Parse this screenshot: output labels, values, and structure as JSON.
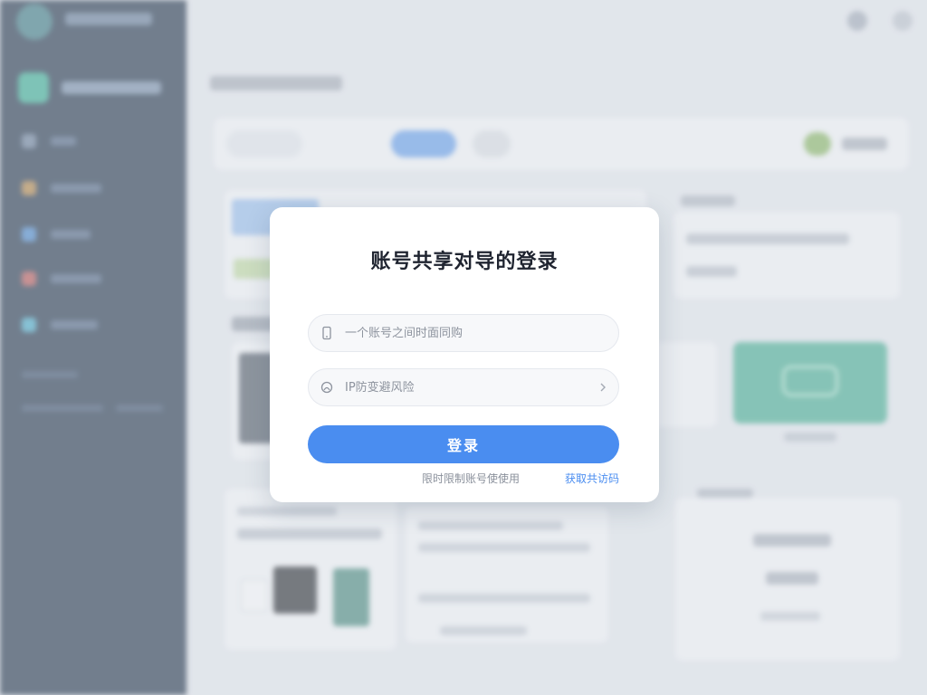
{
  "modal": {
    "title": "账号共享对导的登录",
    "account_field": {
      "placeholder": "一个账号之间时面同购",
      "icon": "phone-icon"
    },
    "ip_field": {
      "placeholder": "IP防变避风险",
      "icon": "shield-icon"
    },
    "login_button": "登录",
    "hint_text": "限时限制账号使使用",
    "link_text": "获取共访码"
  },
  "colors": {
    "primary": "#4a8df0",
    "sidebar": "#14273f",
    "modal_bg": "#ffffff"
  }
}
